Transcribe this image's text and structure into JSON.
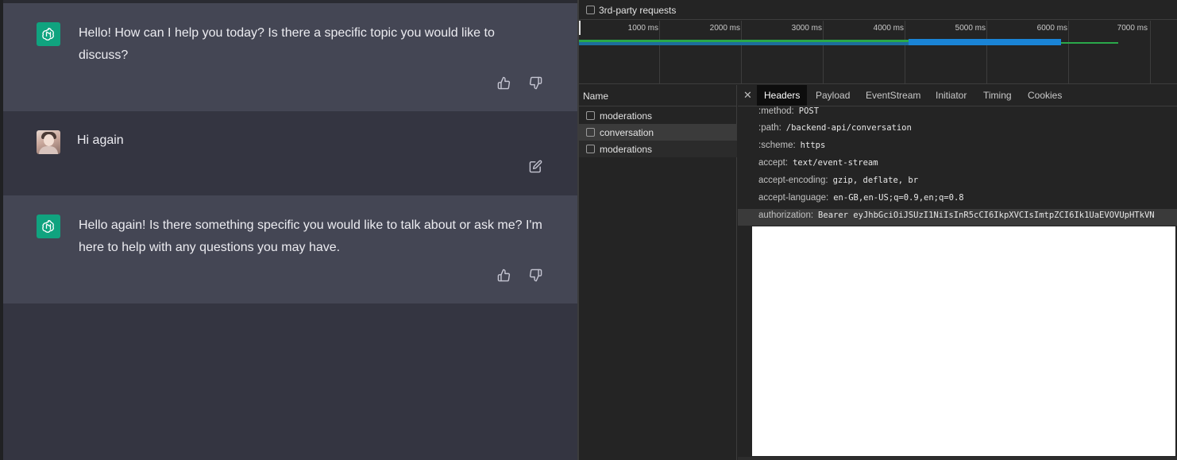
{
  "chat": {
    "messages": [
      {
        "role": "assistant",
        "text": "Hello! How can I help you today? Is there a specific topic you would like to discuss?"
      },
      {
        "role": "user",
        "text": "Hi again"
      },
      {
        "role": "assistant",
        "text": "Hello again! Is there something specific you would like to talk about or ask me? I'm here to help with any questions you may have."
      }
    ]
  },
  "devtools": {
    "filter": {
      "third_party_label": "3rd-party requests",
      "checked": false
    },
    "timeline": {
      "ticks": [
        "1000 ms",
        "2000 ms",
        "3000 ms",
        "4000 ms",
        "5000 ms",
        "6000 ms",
        "7000 ms"
      ],
      "colors": {
        "green": "#2aa84a",
        "blue": "#1a84d6"
      }
    },
    "name_header": "Name",
    "requests": [
      {
        "name": "moderations",
        "selected": false
      },
      {
        "name": "conversation",
        "selected": true
      },
      {
        "name": "moderations",
        "selected": false
      }
    ],
    "tabs": [
      "Headers",
      "Payload",
      "EventStream",
      "Initiator",
      "Timing",
      "Cookies"
    ],
    "active_tab": "Headers",
    "headers": [
      {
        "key": ":method:",
        "value": "POST"
      },
      {
        "key": ":path:",
        "value": "/backend-api/conversation"
      },
      {
        "key": ":scheme:",
        "value": "https"
      },
      {
        "key": "accept:",
        "value": "text/event-stream"
      },
      {
        "key": "accept-encoding:",
        "value": "gzip, deflate, br"
      },
      {
        "key": "accept-language:",
        "value": "en-GB,en-US;q=0.9,en;q=0.8"
      },
      {
        "key": "authorization:",
        "value": "Bearer eyJhbGciOiJSUzI1NiIsInR5cCI6IkpXVCIsImtpZCI6Ik1UaEVOVUpHTkVN"
      }
    ]
  },
  "colors": {
    "chat_bg": "#343541",
    "assistant_bg": "#444654",
    "gpt_green": "#10a37f",
    "devtools_bg": "#242424"
  }
}
